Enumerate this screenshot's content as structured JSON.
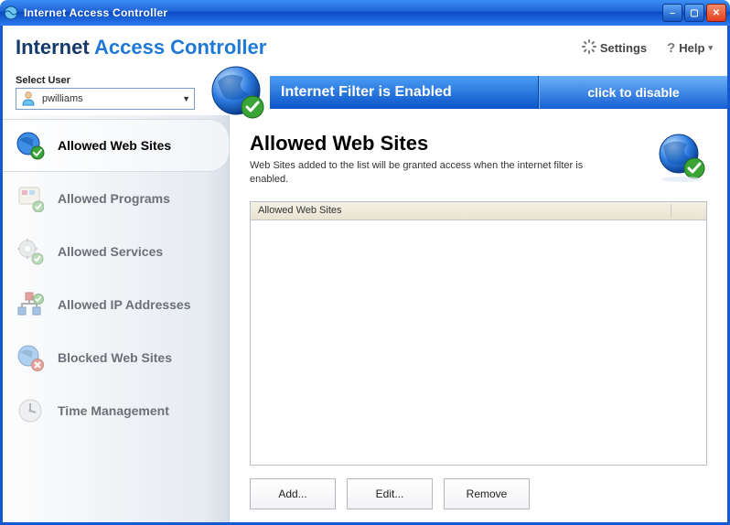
{
  "window": {
    "title": "Internet Access Controller"
  },
  "header": {
    "app_title_part1": "Internet",
    "app_title_part2": "Access Controller",
    "settings_label": "Settings",
    "help_label": "Help"
  },
  "user": {
    "label": "Select User",
    "selected": "pwilliams"
  },
  "banner": {
    "status_text": "Internet Filter is Enabled",
    "action_text": "click to disable"
  },
  "sidebar": {
    "items": [
      {
        "label": "Allowed Web Sites",
        "icon": "globe-check-icon",
        "active": true
      },
      {
        "label": "Allowed Programs",
        "icon": "programs-icon",
        "active": false
      },
      {
        "label": "Allowed Services",
        "icon": "services-icon",
        "active": false
      },
      {
        "label": "Allowed IP Addresses",
        "icon": "ip-icon",
        "active": false
      },
      {
        "label": "Blocked Web Sites",
        "icon": "globe-blocked-icon",
        "active": false
      },
      {
        "label": "Time Management",
        "icon": "clock-icon",
        "active": false
      }
    ]
  },
  "page": {
    "title": "Allowed Web Sites",
    "description": "Web Sites added to the list will be granted access when the internet filter is enabled.",
    "list_header": "Allowed Web Sites",
    "list_rows": []
  },
  "buttons": {
    "add": "Add...",
    "edit": "Edit...",
    "remove": "Remove"
  }
}
